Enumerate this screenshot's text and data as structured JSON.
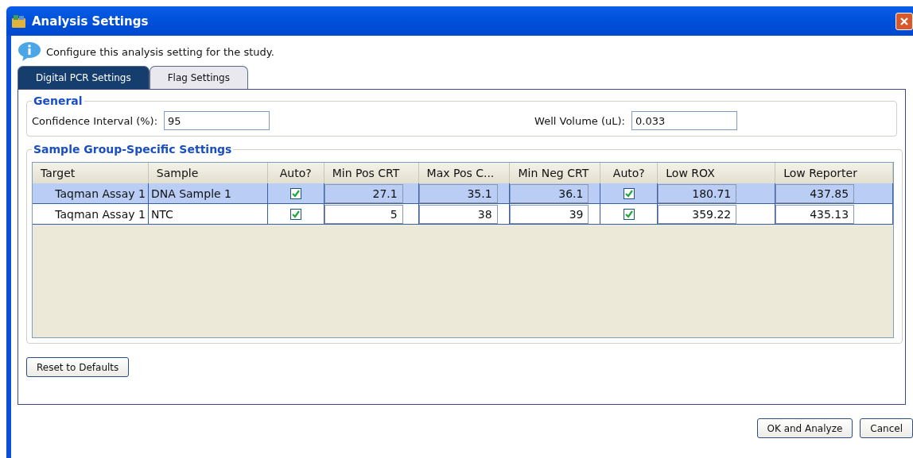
{
  "window": {
    "title": "Analysis Settings"
  },
  "info": "Configure this analysis setting for the study.",
  "tabs": [
    {
      "label": "Digital PCR Settings",
      "selected": true
    },
    {
      "label": "Flag Settings",
      "selected": false
    }
  ],
  "general": {
    "title": "General",
    "fields": [
      {
        "label": "Confidence Interval (%):",
        "value": "95"
      },
      {
        "label": "Well Volume (uL):",
        "value": "0.033"
      }
    ]
  },
  "sample_group": {
    "title": "Sample Group-Specific Settings",
    "columns": [
      {
        "label": "Target",
        "kind": "text"
      },
      {
        "label": "Sample",
        "kind": "text"
      },
      {
        "label": "Auto?",
        "kind": "check"
      },
      {
        "label": "Min Pos CRT",
        "kind": "number"
      },
      {
        "label": "Max Pos C...",
        "kind": "number"
      },
      {
        "label": "Min Neg CRT",
        "kind": "number"
      },
      {
        "label": "Auto?",
        "kind": "check"
      },
      {
        "label": "Low ROX",
        "kind": "number"
      },
      {
        "label": "Low Reporter",
        "kind": "number"
      }
    ],
    "rows": [
      {
        "selected": true,
        "cells": [
          {
            "kind": "text",
            "text": "Taqman Assay 1"
          },
          {
            "kind": "text",
            "text": "DNA Sample 1"
          },
          {
            "kind": "check",
            "checked": true
          },
          {
            "kind": "number",
            "text": "27.1"
          },
          {
            "kind": "number",
            "text": "35.1"
          },
          {
            "kind": "number",
            "text": "36.1"
          },
          {
            "kind": "check",
            "checked": true
          },
          {
            "kind": "number",
            "text": "180.71"
          },
          {
            "kind": "number",
            "text": "437.85"
          }
        ]
      },
      {
        "selected": false,
        "cells": [
          {
            "kind": "text",
            "text": "Taqman Assay 1"
          },
          {
            "kind": "text",
            "text": "NTC"
          },
          {
            "kind": "check",
            "checked": true
          },
          {
            "kind": "number",
            "text": "5"
          },
          {
            "kind": "number",
            "text": "38"
          },
          {
            "kind": "number",
            "text": "39"
          },
          {
            "kind": "check",
            "checked": true
          },
          {
            "kind": "number",
            "text": "359.22"
          },
          {
            "kind": "number",
            "text": "435.13"
          }
        ]
      }
    ]
  },
  "reset_button": "Reset to Defaults",
  "buttons": [
    "OK and Analyze",
    "Cancel"
  ]
}
